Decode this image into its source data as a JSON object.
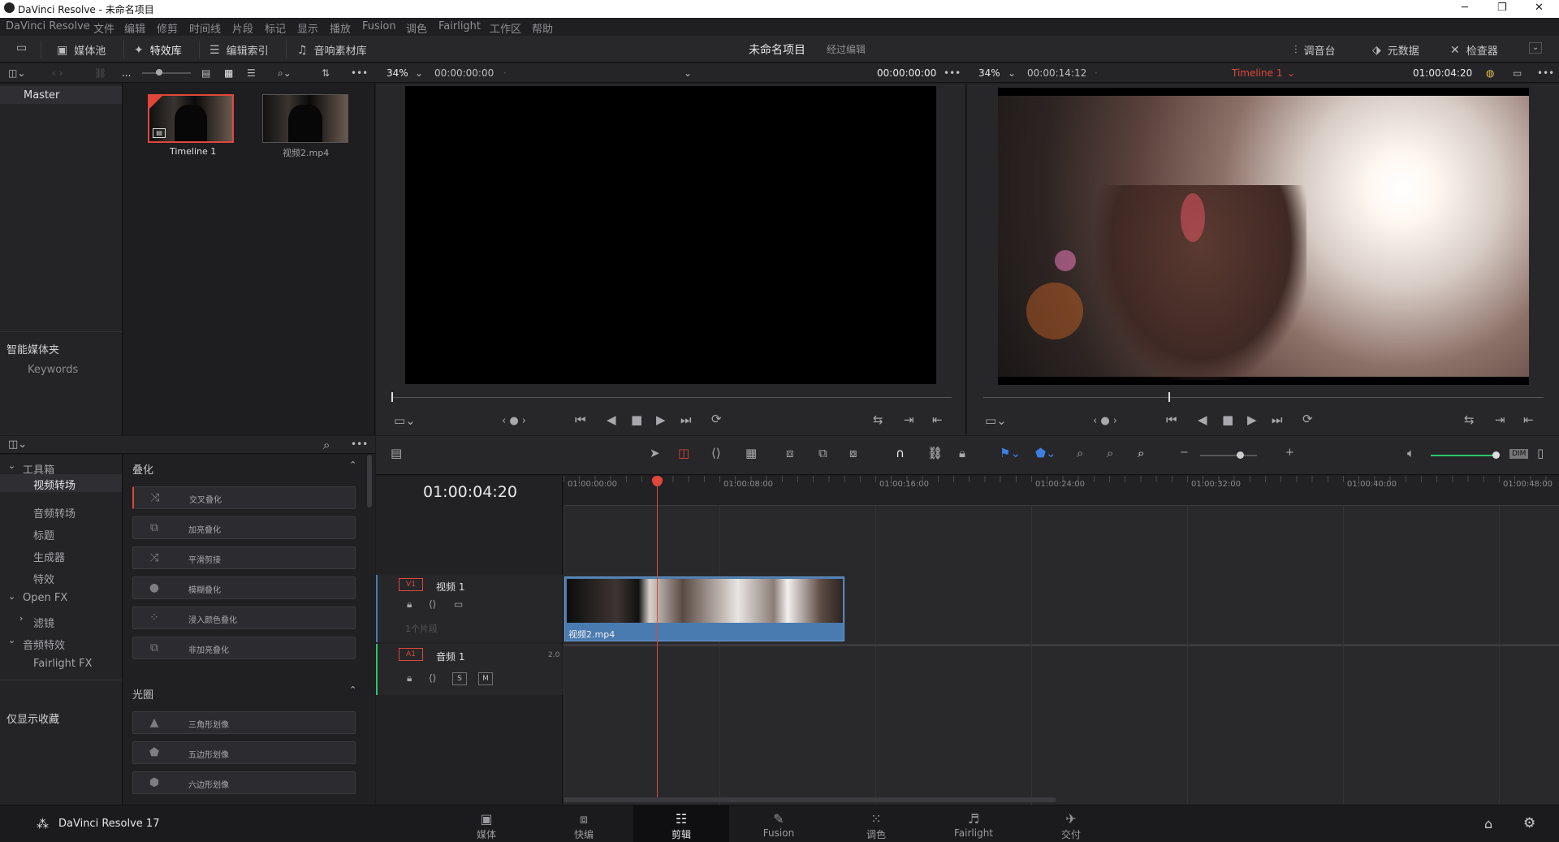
{
  "window": {
    "title": "DaVinci Resolve - 未命名项目"
  },
  "menu": [
    "DaVinci Resolve",
    "文件",
    "编辑",
    "修剪",
    "时间线",
    "片段",
    "标记",
    "显示",
    "播放",
    "Fusion",
    "调色",
    "Fairlight",
    "工作区",
    "帮助"
  ],
  "toolbar": {
    "media_pool": "媒体池",
    "effects": "特效库",
    "edit_index": "编辑索引",
    "sound_library": "音响素材库",
    "project_name": "未命名项目",
    "project_sub": "经过编辑",
    "mixer": "调音台",
    "metadata": "元数据",
    "inspector": "检查器"
  },
  "source_viewer": {
    "zoom": "34%",
    "timecode": "00:00:00:00",
    "duration": "00:00:00:00"
  },
  "timeline_viewer": {
    "zoom": "34%",
    "timecode": "00:00:14:12",
    "timeline_name": "Timeline 1",
    "current_tc": "01:00:04:20"
  },
  "media_pool": {
    "more": "...",
    "bin": "Master",
    "clips": [
      {
        "name": "Timeline 1"
      },
      {
        "name": "视频2.mp4"
      }
    ],
    "smart_bins_title": "智能媒体夹",
    "smart_bins": [
      "Keywords"
    ]
  },
  "effects": {
    "tree": [
      {
        "label": "工具箱",
        "expanded": true
      },
      {
        "label": "视频转场",
        "selected": true
      },
      {
        "label": "音频转场"
      },
      {
        "label": "标题"
      },
      {
        "label": "生成器"
      },
      {
        "label": "特效"
      },
      {
        "label": "Open FX",
        "expanded": true
      },
      {
        "label": "滤镜"
      },
      {
        "label": "音频特效",
        "expanded": true
      },
      {
        "label": "Fairlight FX"
      }
    ],
    "favorites": "仅显示收藏",
    "group1_title": "叠化",
    "group1": [
      "交叉叠化",
      "加亮叠化",
      "平滑剪接",
      "模糊叠化",
      "浸入颜色叠化",
      "非加亮叠化"
    ],
    "group2_title": "光圈",
    "group2": [
      "三角形划像",
      "五边形划像",
      "六边形划像"
    ]
  },
  "timeline": {
    "timecode": "01:00:04:20",
    "ruler": [
      "01:00:00:00",
      "01:00:08:00",
      "01:00:16:00",
      "01:00:24:00",
      "01:00:32:00",
      "01:00:40:00",
      "01:00:48:00"
    ],
    "video_track": {
      "id": "V1",
      "name": "视频 1",
      "clip_count": "1个片段",
      "clip_name": "视频2.mp4"
    },
    "audio_track": {
      "id": "A1",
      "name": "音频 1",
      "channels": "2.0",
      "solo": "S",
      "mute": "M"
    },
    "dim": "DIM"
  },
  "pages": [
    {
      "label": "媒体"
    },
    {
      "label": "快编"
    },
    {
      "label": "剪辑",
      "active": true
    },
    {
      "label": "Fusion"
    },
    {
      "label": "调色"
    },
    {
      "label": "Fairlight"
    },
    {
      "label": "交付"
    }
  ],
  "app_version": "DaVinci Resolve 17",
  "colors": {
    "accent_red": "#e0473a",
    "clip_blue": "#4a7bb0",
    "selected_bg": "#2e2e33"
  }
}
